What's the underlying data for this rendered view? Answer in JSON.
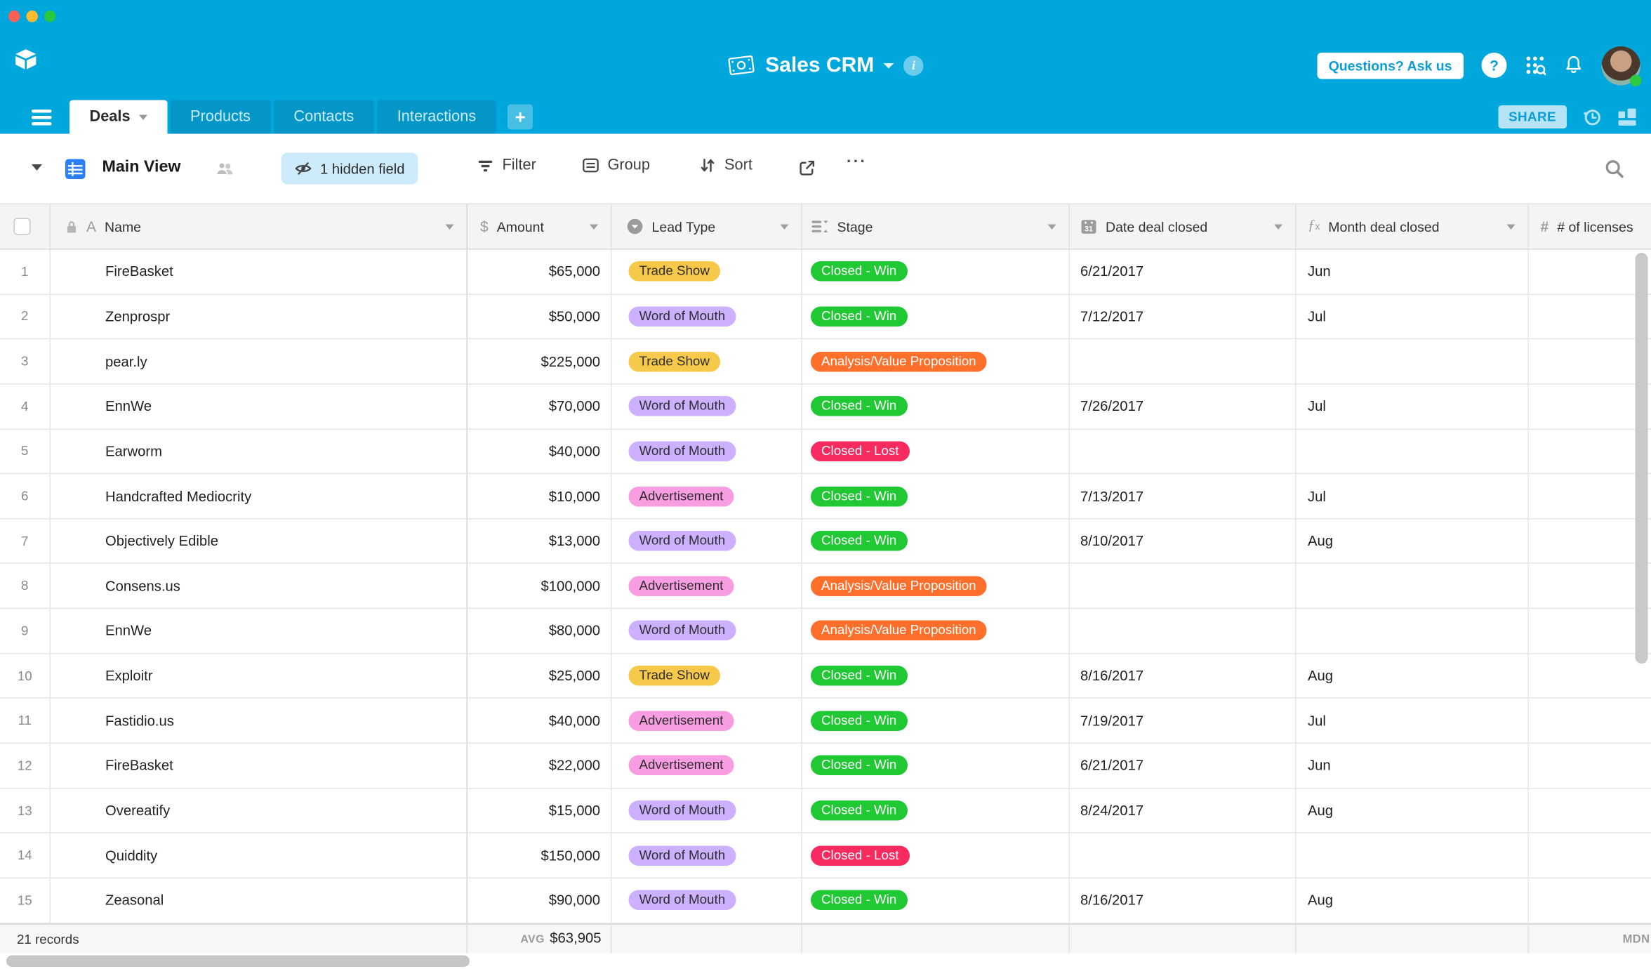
{
  "topbar": {
    "base_name": "Sales CRM",
    "questions_button": "Questions? Ask us",
    "help_icon": "?"
  },
  "tabs": {
    "labels": [
      "Deals",
      "Products",
      "Contacts",
      "Interactions"
    ],
    "active": "Deals",
    "add_label": "+",
    "share_button": "SHARE"
  },
  "toolbar": {
    "view_name": "Main View",
    "hidden_fields_button": "1 hidden field",
    "filter_button": "Filter",
    "group_button": "Group",
    "sort_button": "Sort",
    "more_button": "···"
  },
  "table": {
    "columns": [
      {
        "label": "Name",
        "type": "text"
      },
      {
        "label": "Amount",
        "type": "currency"
      },
      {
        "label": "Lead Type",
        "type": "single-select"
      },
      {
        "label": "Stage",
        "type": "single-select"
      },
      {
        "label": "Date deal closed",
        "type": "date"
      },
      {
        "label": "Month deal closed",
        "type": "formula"
      },
      {
        "label": "# of licenses",
        "type": "number"
      }
    ],
    "column_icon_glyphs": {
      "name": "A",
      "amount": "$",
      "number": "#"
    },
    "rows": [
      {
        "num": "1",
        "name": "FireBasket",
        "amount": "$65,000",
        "lead_type": "Trade Show",
        "stage": "Closed - Win",
        "date": "6/21/2017",
        "month": "Jun"
      },
      {
        "num": "2",
        "name": "Zenprospr",
        "amount": "$50,000",
        "lead_type": "Word of Mouth",
        "stage": "Closed - Win",
        "date": "7/12/2017",
        "month": "Jul"
      },
      {
        "num": "3",
        "name": "pear.ly",
        "amount": "$225,000",
        "lead_type": "Trade Show",
        "stage": "Analysis/Value Proposition",
        "date": "",
        "month": ""
      },
      {
        "num": "4",
        "name": "EnnWe",
        "amount": "$70,000",
        "lead_type": "Word of Mouth",
        "stage": "Closed - Win",
        "date": "7/26/2017",
        "month": "Jul"
      },
      {
        "num": "5",
        "name": "Earworm",
        "amount": "$40,000",
        "lead_type": "Word of Mouth",
        "stage": "Closed - Lost",
        "date": "",
        "month": ""
      },
      {
        "num": "6",
        "name": "Handcrafted Mediocrity",
        "amount": "$10,000",
        "lead_type": "Advertisement",
        "stage": "Closed - Win",
        "date": "7/13/2017",
        "month": "Jul"
      },
      {
        "num": "7",
        "name": "Objectively Edible",
        "amount": "$13,000",
        "lead_type": "Word of Mouth",
        "stage": "Closed - Win",
        "date": "8/10/2017",
        "month": "Aug"
      },
      {
        "num": "8",
        "name": "Consens.us",
        "amount": "$100,000",
        "lead_type": "Advertisement",
        "stage": "Analysis/Value Proposition",
        "date": "",
        "month": ""
      },
      {
        "num": "9",
        "name": "EnnWe",
        "amount": "$80,000",
        "lead_type": "Word of Mouth",
        "stage": "Analysis/Value Proposition",
        "date": "",
        "month": ""
      },
      {
        "num": "10",
        "name": "Exploitr",
        "amount": "$25,000",
        "lead_type": "Trade Show",
        "stage": "Closed - Win",
        "date": "8/16/2017",
        "month": "Aug"
      },
      {
        "num": "11",
        "name": "Fastidio.us",
        "amount": "$40,000",
        "lead_type": "Advertisement",
        "stage": "Closed - Win",
        "date": "7/19/2017",
        "month": "Jul"
      },
      {
        "num": "12",
        "name": "FireBasket",
        "amount": "$22,000",
        "lead_type": "Advertisement",
        "stage": "Closed - Win",
        "date": "6/21/2017",
        "month": "Jun"
      },
      {
        "num": "13",
        "name": "Overeatify",
        "amount": "$15,000",
        "lead_type": "Word of Mouth",
        "stage": "Closed - Win",
        "date": "8/24/2017",
        "month": "Aug"
      },
      {
        "num": "14",
        "name": "Quiddity",
        "amount": "$150,000",
        "lead_type": "Word of Mouth",
        "stage": "Closed - Lost",
        "date": "",
        "month": ""
      },
      {
        "num": "15",
        "name": "Zeasonal",
        "amount": "$90,000",
        "lead_type": "Word of Mouth",
        "stage": "Closed - Win",
        "date": "8/16/2017",
        "month": "Aug"
      }
    ]
  },
  "summary": {
    "records": "21 records",
    "avg_label": "AVG",
    "avg_value": "$63,905",
    "mdn_label": "MDN"
  },
  "colors": {
    "chrome": "#00A7DC",
    "tab_inactive": "#0496C7",
    "grid_view_blue": "#2D7FF9",
    "share_bg": "#B5E4F7",
    "share_text": "#0B9CD8",
    "hidden_field_bg": "#CDEBFA",
    "pills": {
      "Trade Show": {
        "bg": "#F7C94B",
        "fg": "#2E2E2E"
      },
      "Word of Mouth": {
        "bg": "#CDB0FF",
        "fg": "#2E2E2E"
      },
      "Advertisement": {
        "bg": "#F99DE2",
        "fg": "#2E2E2E"
      },
      "Closed - Win": {
        "bg": "#20C933",
        "fg": "#FFFFFF"
      },
      "Closed - Lost": {
        "bg": "#F82B60",
        "fg": "#FFFFFF"
      },
      "Analysis/Value Proposition": {
        "bg": "#FF6F2C",
        "fg": "#FFFFFF"
      }
    }
  }
}
